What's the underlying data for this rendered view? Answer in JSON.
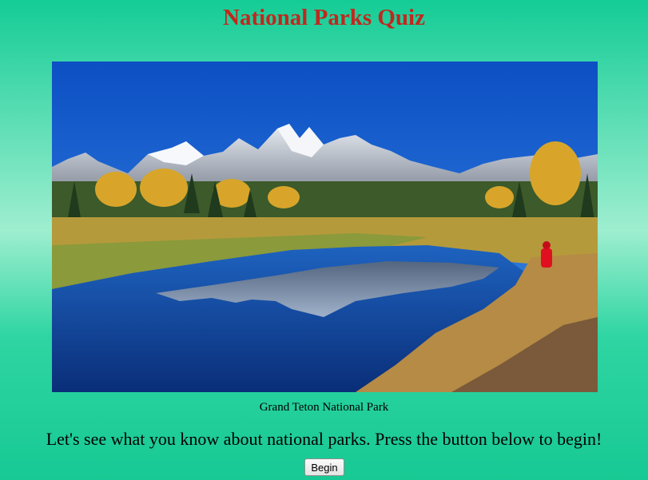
{
  "page": {
    "title": "National Parks Quiz",
    "title_color": "#c0281e",
    "background_colors": [
      "#14cc96",
      "#9eeed0",
      "#17c994"
    ]
  },
  "photo": {
    "alt": "Grand Teton National Park",
    "caption": "Grand Teton National Park"
  },
  "intro": {
    "text": "Let's see what you know about national parks. Press the button below to begin!"
  },
  "actions": {
    "begin_label": "Begin"
  }
}
